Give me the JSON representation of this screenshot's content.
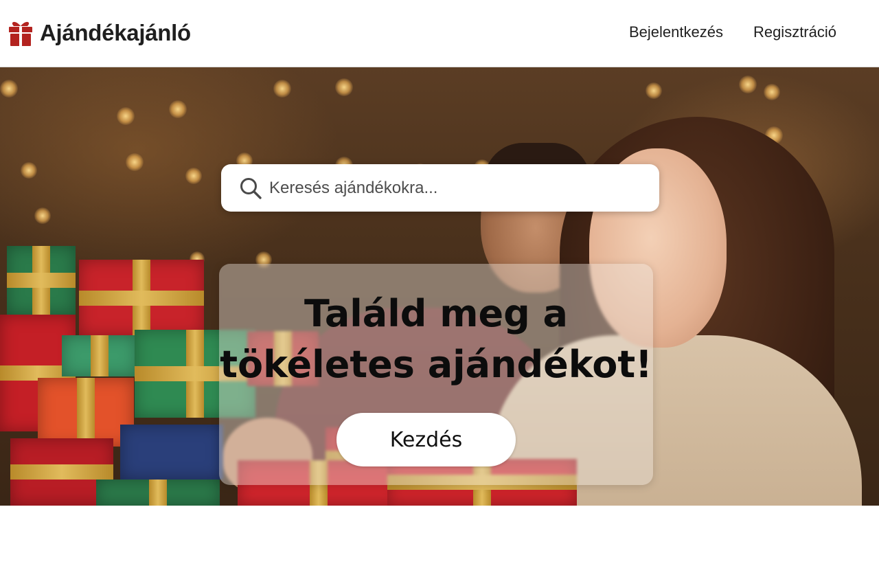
{
  "header": {
    "brand_name": "Ajándékajánló",
    "brand_icon": "gift-icon",
    "brand_color": "#b3231f",
    "nav": {
      "login_label": "Bejelentkezés",
      "register_label": "Regisztráció"
    }
  },
  "hero": {
    "search": {
      "placeholder": "Keresés ajándékokra...",
      "icon": "search-icon"
    },
    "headline_line1": "Találd meg a",
    "headline_line2": "tökéletes ajándékot!",
    "cta_label": "Kezdés",
    "image_description_icon": "hero-photo"
  }
}
